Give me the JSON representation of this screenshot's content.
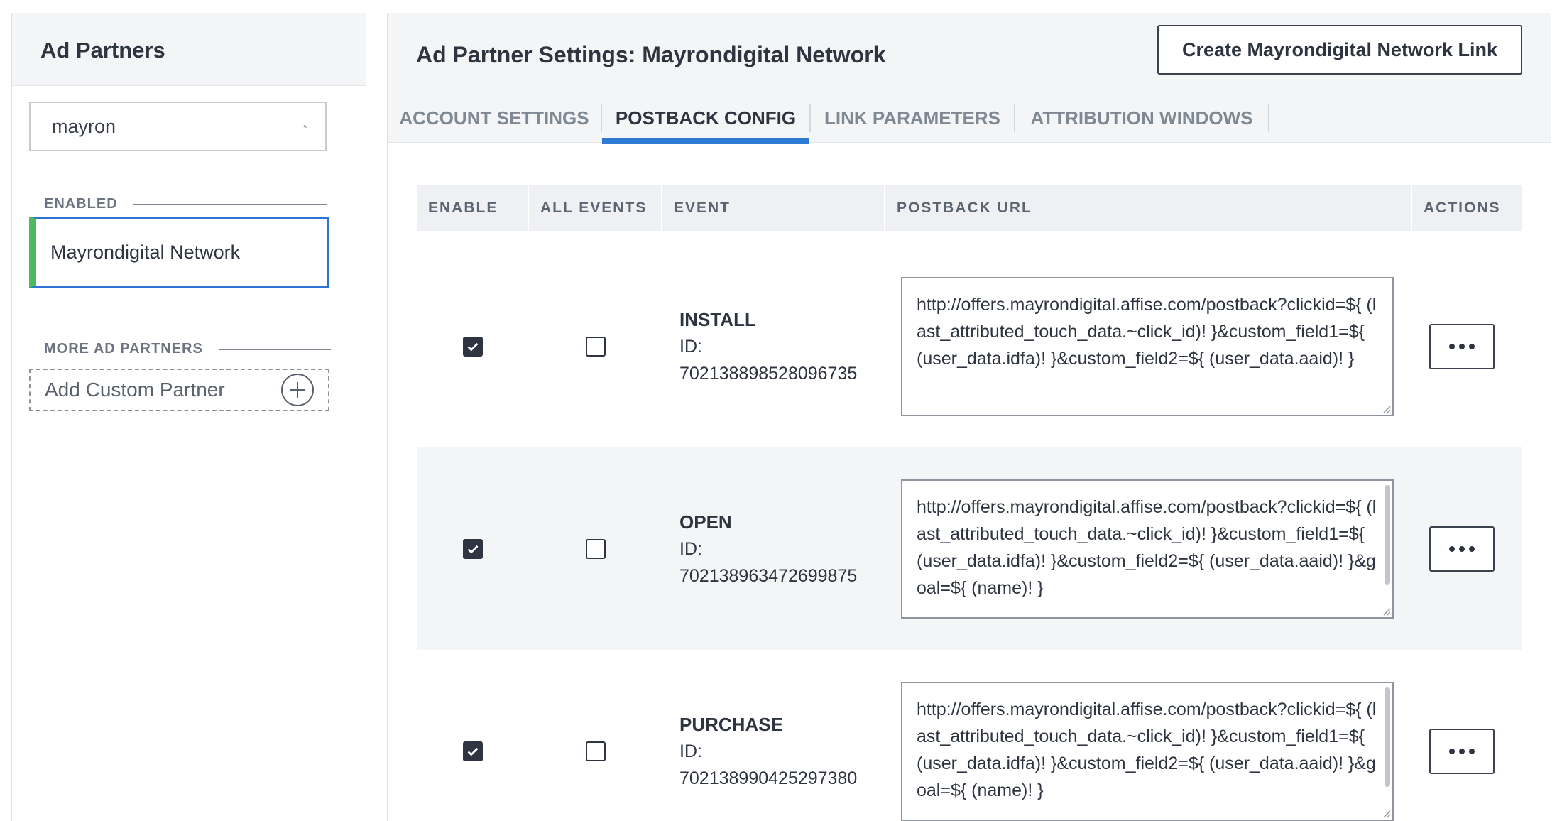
{
  "left": {
    "title": "Ad Partners",
    "search": {
      "value": "mayron",
      "placeholder": ""
    },
    "enabled_label": "ENABLED",
    "enabled_items": [
      "Mayrondigital Network"
    ],
    "more_label": "MORE AD PARTNERS",
    "add_custom": "Add Custom Partner"
  },
  "right": {
    "title": "Ad Partner Settings: Mayrondigital Network",
    "create_button": "Create Mayrondigital Network Link",
    "tabs": [
      {
        "label": "ACCOUNT SETTINGS",
        "active": false
      },
      {
        "label": "POSTBACK CONFIG",
        "active": true
      },
      {
        "label": "LINK PARAMETERS",
        "active": false
      },
      {
        "label": "ATTRIBUTION WINDOWS",
        "active": false
      }
    ],
    "table": {
      "headers": [
        "ENABLE",
        "ALL EVENTS",
        "EVENT",
        "POSTBACK URL",
        "ACTIONS"
      ],
      "rows": [
        {
          "enabled": true,
          "all_events": false,
          "event": "INSTALL",
          "id_label": "ID:",
          "id": "702138898528096735",
          "url": "http://offers.mayrondigital.affise.com/postback?clickid=${ (last_attributed_touch_data.~click_id)! }&custom_field1=${ (user_data.idfa)! }&custom_field2=${ (user_data.aaid)! }"
        },
        {
          "enabled": true,
          "all_events": false,
          "event": "OPEN",
          "id_label": "ID:",
          "id": "702138963472699875",
          "url": "http://offers.mayrondigital.affise.com/postback?clickid=${ (last_attributed_touch_data.~click_id)! }&custom_field1=${ (user_data.idfa)! }&custom_field2=${ (user_data.aaid)! }&goal=${ (name)! }"
        },
        {
          "enabled": true,
          "all_events": false,
          "event": "PURCHASE",
          "id_label": "ID:",
          "id": "702138990425297380",
          "url": "http://offers.mayrondigital.affise.com/postback?clickid=${ (last_attributed_touch_data.~click_id)! }&custom_field1=${ (user_data.idfa)! }&custom_field2=${ (user_data.aaid)! }&goal=${ (name)! }"
        }
      ]
    }
  },
  "colors": {
    "accent_blue": "#2e7bd6",
    "enabled_green": "#4cba61",
    "text_dark": "#2f3540",
    "header_bg": "#f4f5f7"
  }
}
